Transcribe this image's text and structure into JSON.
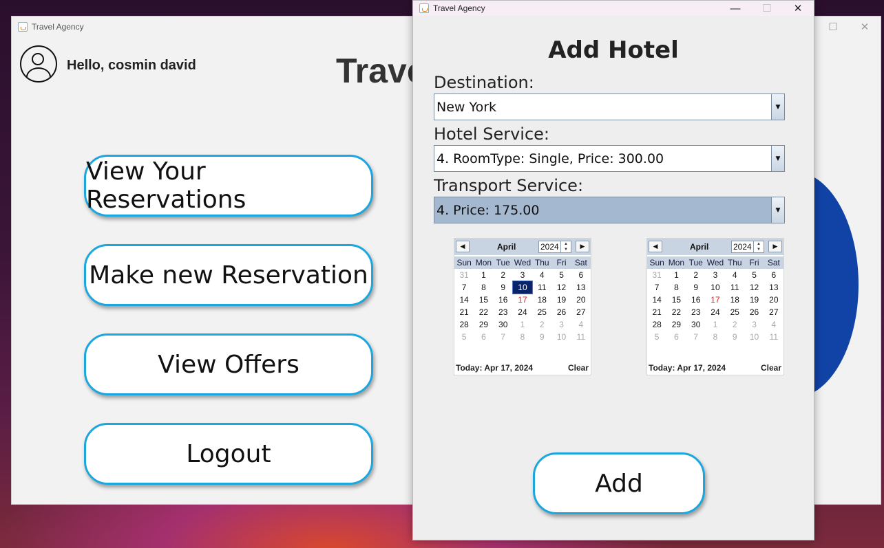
{
  "main_window": {
    "title": "Travel Agency",
    "greeting": "Hello, cosmin david",
    "heading": "Travel",
    "controls": {
      "minimize": "—",
      "maximize": "☐",
      "close": "✕"
    },
    "buttons": [
      {
        "label": "View Your Reservations"
      },
      {
        "label": "Make new Reservation"
      },
      {
        "label": "View Offers"
      },
      {
        "label": "Logout"
      }
    ]
  },
  "dialog": {
    "title": "Travel Agency",
    "controls": {
      "minimize": "—",
      "maximize": "☐",
      "close": "✕"
    },
    "heading": "Add Hotel",
    "destination": {
      "label": "Destination:",
      "value": "New York"
    },
    "hotel_service": {
      "label": "Hotel Service:",
      "value": "4. RoomType: Single, Price: 300.00"
    },
    "transport_service": {
      "label": "Transport Service:",
      "value": "4. Price: 175.00"
    },
    "calendars": [
      {
        "month": "April",
        "year": "2024",
        "weekdays": [
          "Sun",
          "Mon",
          "Tue",
          "Wed",
          "Thu",
          "Fri",
          "Sat"
        ],
        "weeks": [
          [
            "31",
            "1",
            "2",
            "3",
            "4",
            "5",
            "6"
          ],
          [
            "7",
            "8",
            "9",
            "10",
            "11",
            "12",
            "13"
          ],
          [
            "14",
            "15",
            "16",
            "17",
            "18",
            "19",
            "20"
          ],
          [
            "21",
            "22",
            "23",
            "24",
            "25",
            "26",
            "27"
          ],
          [
            "28",
            "29",
            "30",
            "1",
            "2",
            "3",
            "4"
          ],
          [
            "5",
            "6",
            "7",
            "8",
            "9",
            "10",
            "11"
          ]
        ],
        "selected_day": "10",
        "today_day": "17",
        "today_text": "Today: Apr 17, 2024",
        "clear_text": "Clear"
      },
      {
        "month": "April",
        "year": "2024",
        "weekdays": [
          "Sun",
          "Mon",
          "Tue",
          "Wed",
          "Thu",
          "Fri",
          "Sat"
        ],
        "weeks": [
          [
            "31",
            "1",
            "2",
            "3",
            "4",
            "5",
            "6"
          ],
          [
            "7",
            "8",
            "9",
            "10",
            "11",
            "12",
            "13"
          ],
          [
            "14",
            "15",
            "16",
            "17",
            "18",
            "19",
            "20"
          ],
          [
            "21",
            "22",
            "23",
            "24",
            "25",
            "26",
            "27"
          ],
          [
            "28",
            "29",
            "30",
            "1",
            "2",
            "3",
            "4"
          ],
          [
            "5",
            "6",
            "7",
            "8",
            "9",
            "10",
            "11"
          ]
        ],
        "selected_day": null,
        "today_day": "17",
        "today_text": "Today: Apr 17, 2024",
        "clear_text": "Clear"
      }
    ],
    "add_label": "Add"
  },
  "colors": {
    "button_border": "#1aa7e0",
    "selected_date": "#0a246a",
    "today": "#e02020",
    "combo_selected": "#a4b8d0"
  }
}
